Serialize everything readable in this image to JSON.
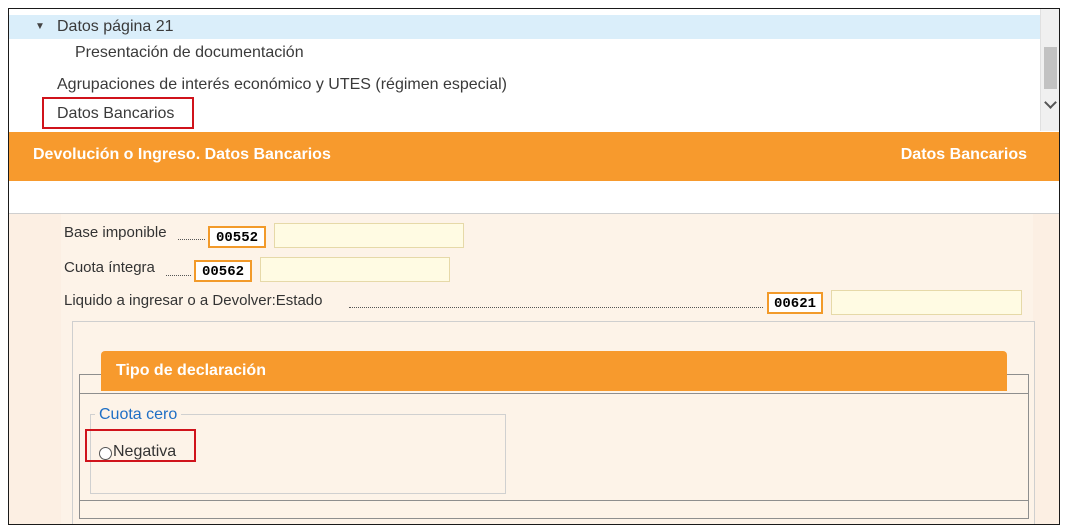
{
  "tree": {
    "items": [
      {
        "label": "Datos página 21"
      },
      {
        "label": "Presentación de documentación"
      },
      {
        "label": "Agrupaciones de interés económico y UTES (régimen especial)"
      },
      {
        "label": "Datos Bancarios"
      }
    ]
  },
  "section_header": {
    "left_title": "Devolución o Ingreso. Datos Bancarios",
    "right_title": "Datos Bancarios"
  },
  "form": {
    "fields": [
      {
        "label": "Base imponible",
        "code": "00552",
        "value": ""
      },
      {
        "label": "Cuota íntegra",
        "code": "00562",
        "value": ""
      },
      {
        "label": "Liquido a ingresar o a Devolver:Estado",
        "code": "00621",
        "value": ""
      }
    ]
  },
  "declaration": {
    "title": "Tipo de declaración",
    "group_legend": "Cuota cero",
    "options": [
      {
        "label": "Negativa",
        "selected": false
      }
    ]
  },
  "colors": {
    "accent_orange": "#f79a2d",
    "highlight_red": "#d0131b",
    "selected_row": "#daeefa",
    "legend_blue": "#1f6fc5"
  }
}
